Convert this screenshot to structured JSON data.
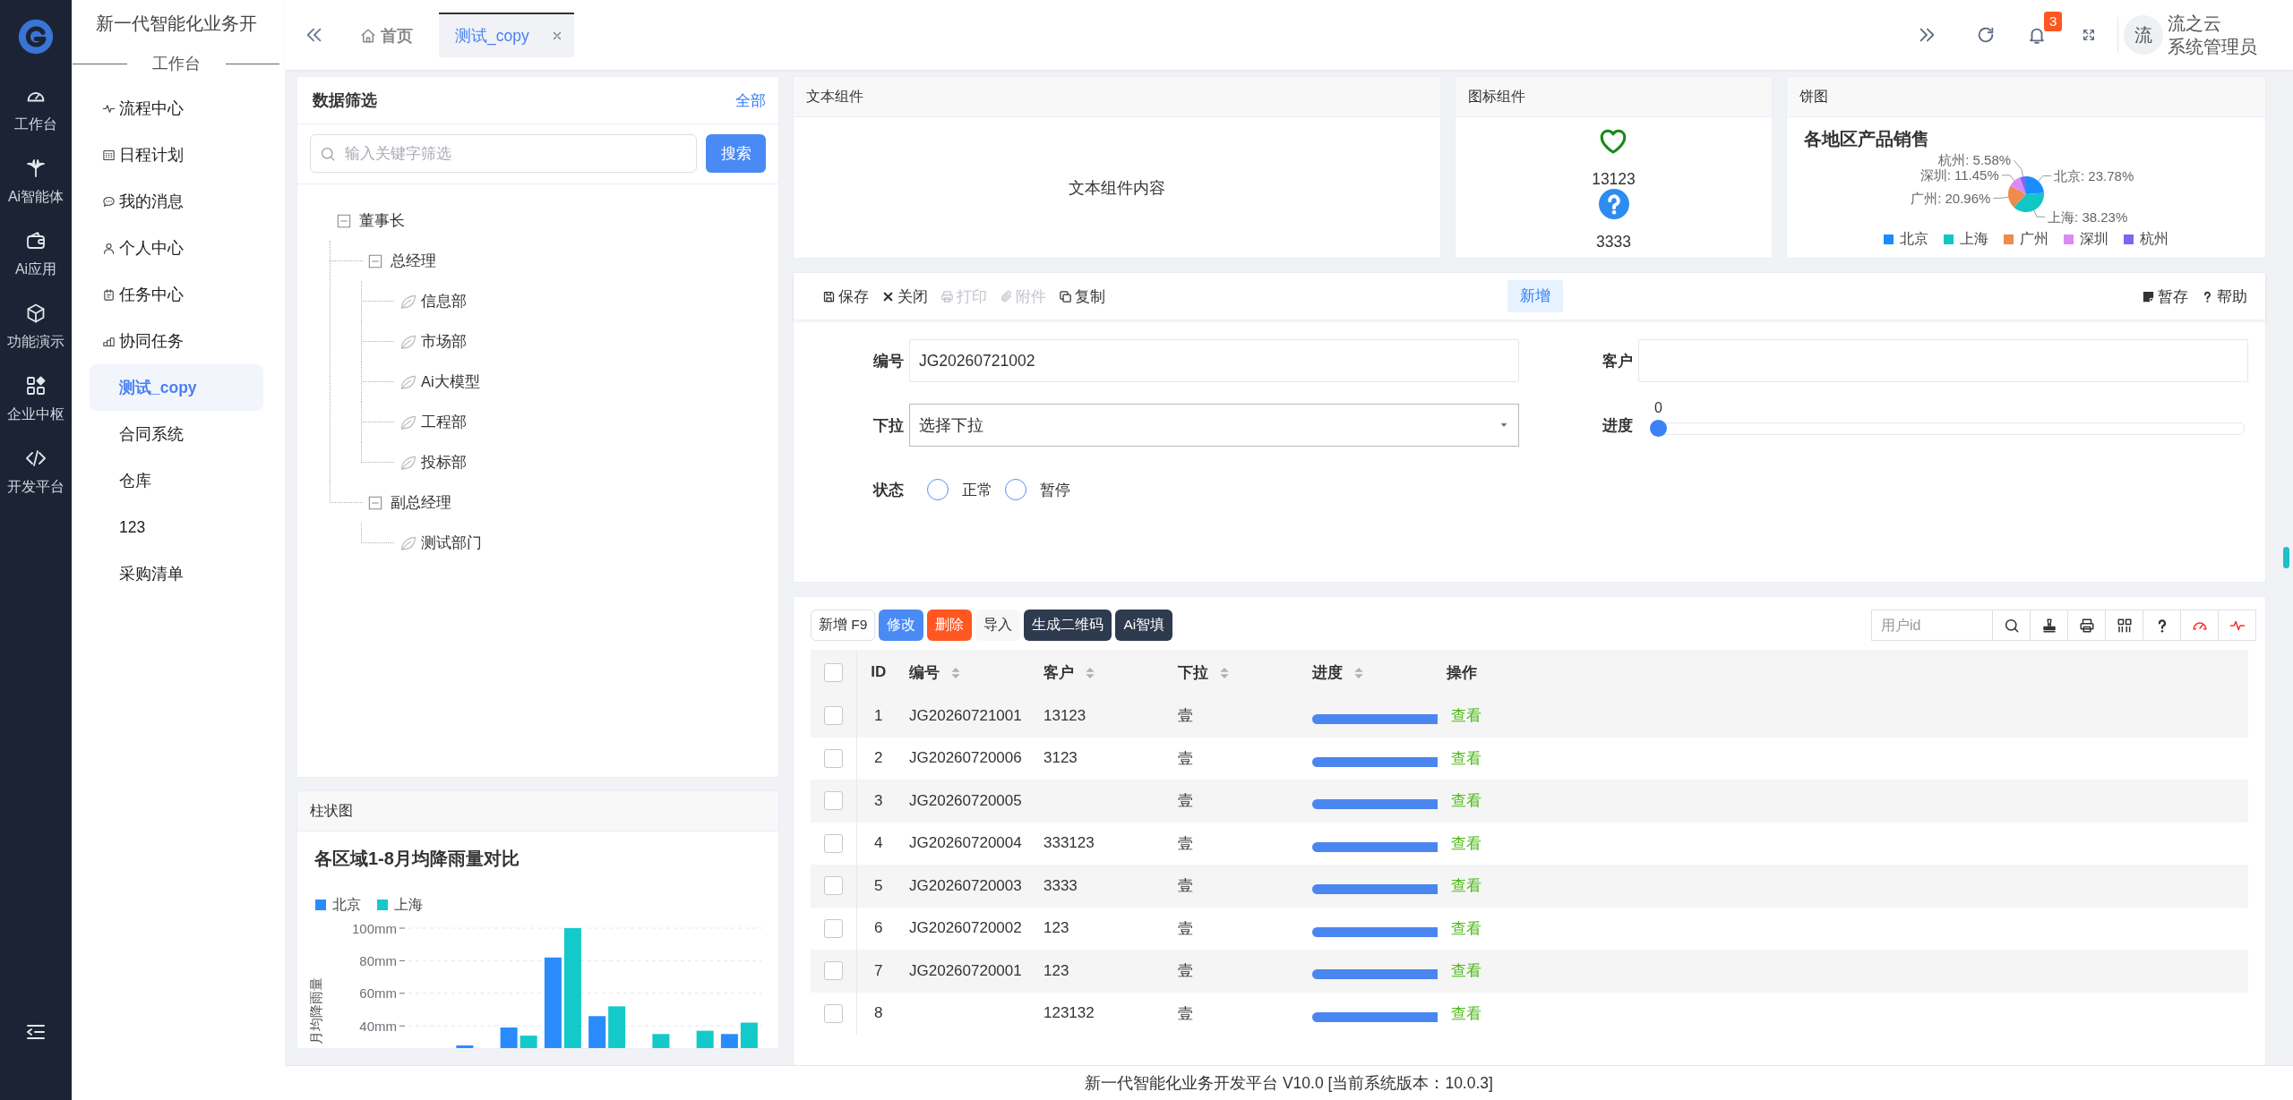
{
  "rail": {
    "items": [
      {
        "label": "工作台"
      },
      {
        "label": "Ai智能体"
      },
      {
        "label": "Ai应用"
      },
      {
        "label": "功能演示"
      },
      {
        "label": "企业中枢"
      },
      {
        "label": "开发平台"
      }
    ]
  },
  "menu": {
    "title": "新一代智能化业务开",
    "section": "工作台",
    "items": [
      {
        "label": "流程中心",
        "kind": "icon",
        "selected": false
      },
      {
        "label": "日程计划",
        "kind": "icon",
        "selected": false
      },
      {
        "label": "我的消息",
        "kind": "icon",
        "selected": false
      },
      {
        "label": "个人中心",
        "kind": "icon",
        "selected": false
      },
      {
        "label": "任务中心",
        "kind": "icon",
        "selected": false
      },
      {
        "label": "协同任务",
        "kind": "icon",
        "selected": false
      },
      {
        "label": "测试_copy",
        "kind": "plain",
        "selected": true
      },
      {
        "label": "合同系统",
        "kind": "plain",
        "selected": false
      },
      {
        "label": "仓库",
        "kind": "plain",
        "selected": false
      },
      {
        "label": "123",
        "kind": "plain",
        "selected": false
      },
      {
        "label": "采购清单",
        "kind": "plain",
        "selected": false
      }
    ]
  },
  "tabs": [
    {
      "label": "首页",
      "kind": "home",
      "selected": false
    },
    {
      "label": "测试_copy",
      "kind": "page",
      "selected": true
    }
  ],
  "header": {
    "badge": "3",
    "avatar": "流",
    "user_name": "流之云",
    "user_role": "系统管理员"
  },
  "filter_panel": {
    "title": "数据筛选",
    "link": "全部",
    "search": {
      "placeholder": "输入关键字筛选"
    },
    "search_button": "搜索",
    "tree": [
      {
        "label": "董事长",
        "expanded": true,
        "children": [
          {
            "label": "总经理",
            "expanded": true,
            "children": [
              {
                "label": "信息部"
              },
              {
                "label": "市场部"
              },
              {
                "label": "Ai大模型"
              },
              {
                "label": "工程部"
              },
              {
                "label": "投标部"
              }
            ]
          },
          {
            "label": "副总经理",
            "expanded": true,
            "children": [
              {
                "label": "测试部门"
              }
            ]
          }
        ]
      }
    ]
  },
  "bar_panel": {
    "header": "柱状图",
    "chart_data": {
      "type": "bar",
      "title": "各区域1-8月均降雨量对比",
      "ylabel": "月均降雨量",
      "legend": "top-left",
      "grid": true,
      "series": [
        {
          "name": "北京",
          "color": "#2a8bfd",
          "values": [
            null,
            28,
            39,
            82,
            46,
            null,
            null,
            35
          ]
        },
        {
          "name": "上海",
          "color": "#14c9c9",
          "values": [
            null,
            null,
            34,
            100,
            52,
            35,
            37,
            42
          ]
        }
      ],
      "ylim": [
        25,
        100
      ],
      "yticks": [
        {
          "value": 40,
          "label": "40mm"
        },
        {
          "value": 60,
          "label": "60mm"
        },
        {
          "value": 80,
          "label": "80mm"
        },
        {
          "value": 100,
          "label": "100mm"
        }
      ]
    }
  },
  "text_panel": {
    "header": "文本组件",
    "content": "文本组件内容"
  },
  "icon_panel": {
    "header": "图标组件",
    "items": [
      {
        "caption": "13123"
      },
      {
        "caption": "3333"
      }
    ]
  },
  "pie_panel": {
    "header": "饼图",
    "chart_data": {
      "type": "pie",
      "title": "各地区产品销售",
      "legend": "bottom",
      "categories": [
        "北京",
        "上海",
        "广州",
        "深圳",
        "杭州"
      ],
      "values": [
        23.78,
        38.23,
        20.96,
        11.45,
        5.58
      ],
      "colors": [
        "#1a8cff",
        "#13c6c6",
        "#ef8b4c",
        "#d98af5",
        "#7a68f5"
      ],
      "value_labels": [
        "北京: 23.78%",
        "上海: 38.23%",
        "广州: 20.96%",
        "深圳: 11.45%",
        "杭州: 5.58%"
      ]
    }
  },
  "form_panel": {
    "toolbar": [
      {
        "label": "保存",
        "disabled": false
      },
      {
        "label": "关闭",
        "disabled": false
      },
      {
        "label": "打印",
        "disabled": true
      },
      {
        "label": "附件",
        "disabled": true
      },
      {
        "label": "复制",
        "disabled": false
      }
    ],
    "mode": "新增",
    "toolbar_right": [
      {
        "label": "暂存"
      },
      {
        "label": "帮助"
      }
    ],
    "rows": [
      {
        "fields": [
          {
            "kind": "text",
            "label": "编号",
            "value": "JG20260721002"
          },
          {
            "kind": "text",
            "label": "客户"
          }
        ]
      },
      {
        "fields": [
          {
            "kind": "select",
            "label": "下拉",
            "value": "选择下拉"
          },
          {
            "kind": "slider",
            "label": "进度",
            "reading": "0",
            "level": 0
          }
        ]
      },
      {
        "fields": [
          {
            "kind": "radio",
            "label": "状态",
            "options": [
              {
                "label": "正常",
                "selected": false
              },
              {
                "label": "暂停",
                "selected": false
              }
            ]
          }
        ]
      }
    ]
  },
  "table_panel": {
    "buttons": [
      {
        "label": "新增 F9",
        "kind": "outline"
      },
      {
        "label": "修改",
        "kind": "primary"
      },
      {
        "label": "删除",
        "kind": "danger"
      },
      {
        "label": "导入",
        "kind": "plain"
      },
      {
        "label": "生成二维码",
        "kind": "dark"
      },
      {
        "label": "Ai智填",
        "kind": "dark"
      }
    ],
    "search": {
      "placeholder": "用户id"
    },
    "all_checked": false,
    "columns": [
      {
        "label": "ID",
        "sortable": false
      },
      {
        "label": "编号",
        "sortable": true
      },
      {
        "label": "客户",
        "sortable": true
      },
      {
        "label": "下拉",
        "sortable": true
      },
      {
        "label": "进度",
        "sortable": true
      },
      {
        "label": "操作",
        "sortable": false
      }
    ],
    "rows": [
      {
        "checked": false,
        "id": "1",
        "code": "JG20260721001",
        "customer": "13123",
        "dropdown": "壹",
        "level": 1,
        "action": "查看"
      },
      {
        "checked": false,
        "id": "2",
        "code": "JG20260720006",
        "customer": "3123",
        "dropdown": "壹",
        "level": 1,
        "action": "查看"
      },
      {
        "checked": false,
        "id": "3",
        "code": "JG20260720005",
        "dropdown": "壹",
        "level": 1,
        "action": "查看"
      },
      {
        "checked": false,
        "id": "4",
        "code": "JG20260720004",
        "customer": "333123",
        "dropdown": "壹",
        "level": 1,
        "action": "查看"
      },
      {
        "checked": false,
        "id": "5",
        "code": "JG20260720003",
        "customer": "3333",
        "dropdown": "壹",
        "level": 1,
        "action": "查看"
      },
      {
        "checked": false,
        "id": "6",
        "code": "JG20260720002",
        "customer": "123",
        "dropdown": "壹",
        "level": 1,
        "action": "查看"
      },
      {
        "checked": false,
        "id": "7",
        "code": "JG20260720001",
        "customer": "123",
        "dropdown": "壹",
        "level": 1,
        "action": "查看"
      },
      {
        "checked": false,
        "id": "8",
        "customer": "123132",
        "dropdown": "壹",
        "level": 1,
        "action": "查看"
      }
    ]
  },
  "footer": "新一代智能化业务开发平台 V10.0 [当前系统版本：10.0.3]"
}
